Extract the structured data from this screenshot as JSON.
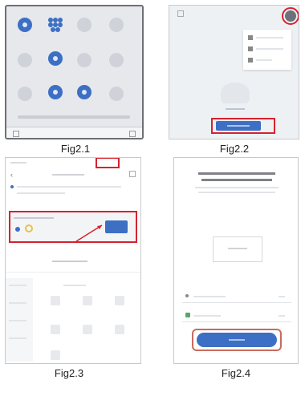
{
  "captions": {
    "fig1": "Fig2.1",
    "fig2": "Fig2.2",
    "fig3": "Fig2.3",
    "fig4": "Fig2.4"
  },
  "colors": {
    "highlight": "#d6222e",
    "accent_blue": "#3d6fc4"
  },
  "fig1": {
    "tile_states": [
      "on",
      "on",
      "off",
      "off",
      "off",
      "on",
      "off",
      "off",
      "off",
      "on",
      "on",
      "off"
    ]
  },
  "fig2": {
    "menu_icon": "plus-icon",
    "menu_items": [
      "",
      "",
      ""
    ],
    "add_button": ""
  },
  "fig3": {
    "title": "",
    "discovering_label": "",
    "add_button": ""
  },
  "fig4": {
    "heading": "",
    "next_button": ""
  }
}
